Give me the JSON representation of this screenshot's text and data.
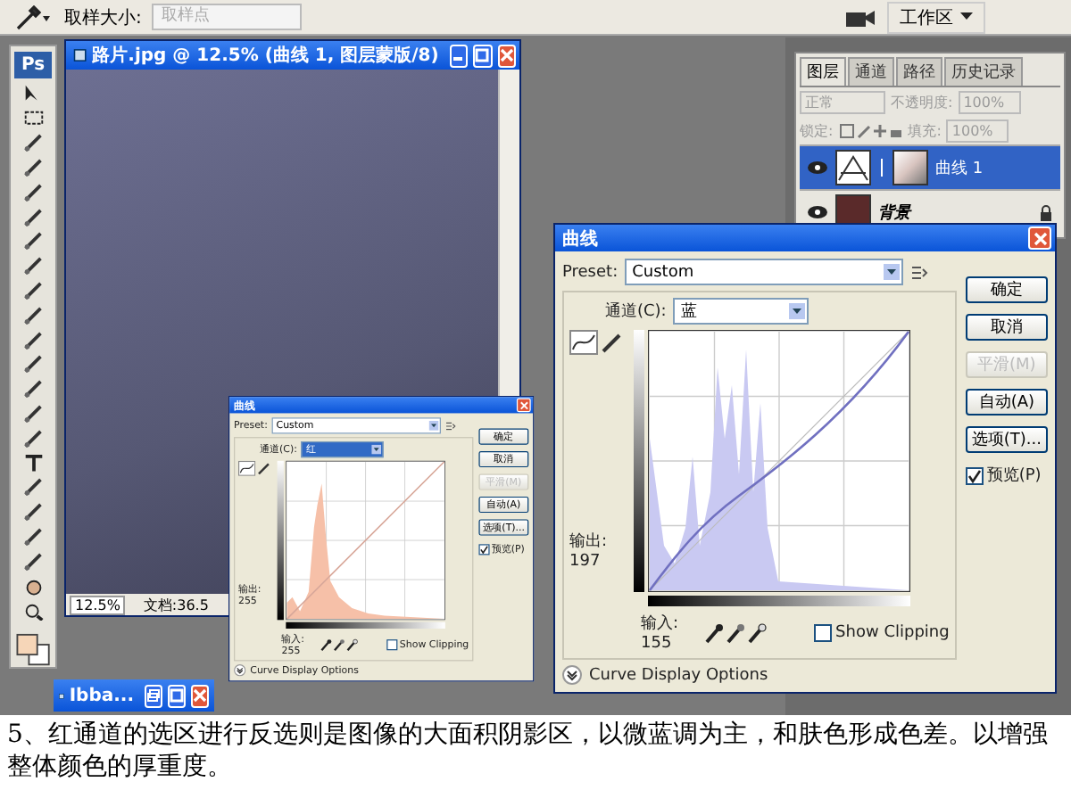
{
  "options_bar": {
    "size_label": "取样大小:",
    "size_value": "取样点",
    "size_disabled": true,
    "workspace": "工作区"
  },
  "toolbox": {
    "logo": "Ps"
  },
  "document": {
    "title": "路片.jpg @ 12.5% (曲线 1, 图层蒙版/8)",
    "zoom": "12.5%",
    "doc_info": "文档:36.5"
  },
  "layers_panel": {
    "tabs": [
      {
        "label": "图层",
        "selected": true
      },
      {
        "label": "通道",
        "selected": false
      },
      {
        "label": "路径",
        "selected": false
      },
      {
        "label": "历史记录",
        "selected": false
      }
    ],
    "blend_mode": "正常",
    "opacity_label": "不透明度:",
    "opacity": "100%",
    "lock_label": "锁定:",
    "fill_label": "填充:",
    "fill": "100%",
    "layers": [
      {
        "name": "曲线 1",
        "kind": "adjustment",
        "selected": true,
        "visible": true,
        "locked": false
      },
      {
        "name": "背景",
        "kind": "image",
        "selected": false,
        "visible": true,
        "locked": true
      }
    ]
  },
  "curves_dialogs": [
    {
      "title": "曲线",
      "preset_label": "Preset:",
      "preset": "Custom",
      "channel_label": "通道(C):",
      "channel": "红",
      "color": "#f6c0a8",
      "channel_focused": true,
      "buttons": [
        {
          "label": "确定",
          "disabled": false
        },
        {
          "label": "取消",
          "disabled": false
        },
        {
          "label": "平滑(M)",
          "disabled": true
        },
        {
          "label": "自动(A)",
          "disabled": false
        },
        {
          "label": "选项(T)...",
          "disabled": false
        }
      ],
      "preview_label": "预览(P)",
      "preview_checked": true,
      "output_label": "输出:",
      "output": "255",
      "input_label": "输入:",
      "input": "255",
      "show_clipping": "Show Clipping",
      "show_clipping_checked": false,
      "display_options": "Curve Display Options"
    },
    {
      "title": "曲线",
      "preset_label": "Preset:",
      "preset": "Custom",
      "channel_label": "通道(C):",
      "channel": "蓝",
      "color": "#c9c9f2",
      "channel_focused": false,
      "buttons": [
        {
          "label": "确定",
          "disabled": false
        },
        {
          "label": "取消",
          "disabled": false
        },
        {
          "label": "平滑(M)",
          "disabled": true
        },
        {
          "label": "自动(A)",
          "disabled": false
        },
        {
          "label": "选项(T)...",
          "disabled": false
        }
      ],
      "preview_label": "预览(P)",
      "preview_checked": true,
      "output_label": "输出:",
      "output": "197",
      "input_label": "输入:",
      "input": "155",
      "show_clipping": "Show Clipping",
      "show_clipping_checked": false,
      "display_options": "Curve Display Options"
    }
  ],
  "minimized_window": {
    "title": "Ibba..."
  },
  "caption": "5、红通道的选区进行反选则是图像的大面积阴影区，以微蓝调为主，和肤色形成色差。以增强整体颜色的厚重度。"
}
